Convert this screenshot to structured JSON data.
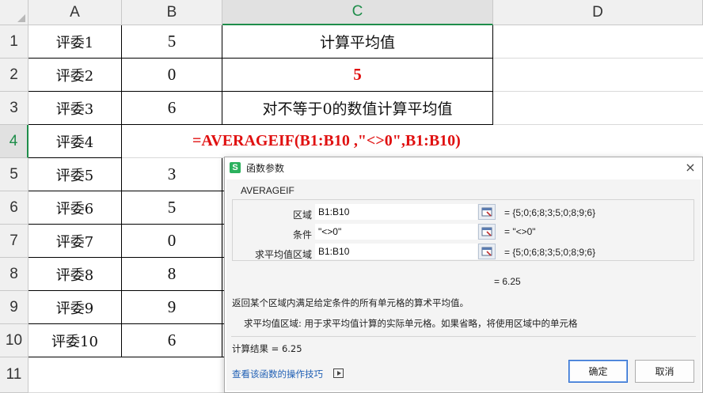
{
  "columns": [
    "A",
    "B",
    "C",
    "D"
  ],
  "rows": [
    "1",
    "2",
    "3",
    "4",
    "5",
    "6",
    "7",
    "8",
    "9",
    "10",
    "11"
  ],
  "cells": {
    "A": [
      "评委1",
      "评委2",
      "评委3",
      "评委4",
      "评委5",
      "评委6",
      "评委7",
      "评委8",
      "评委9",
      "评委10"
    ],
    "B": [
      "5",
      "0",
      "6",
      "",
      "3",
      "5",
      "0",
      "8",
      "9",
      "6"
    ],
    "C1": "计算平均值",
    "C2": "5",
    "C3": "对不等于0的数值计算平均值",
    "formula": "=AVERAGEIF(B1:B10 ,\"<>0\",B1:B10)"
  },
  "dialog": {
    "title": "函数参数",
    "close": "×",
    "function_name": "AVERAGEIF",
    "args": [
      {
        "label": "区域",
        "value": "B1:B10",
        "result": "=  {5;0;6;8;3;5;0;8;9;6}"
      },
      {
        "label": "条件",
        "value": "\"<>0\"",
        "result": "=  \"<>0\""
      },
      {
        "label": "求平均值区域",
        "value": "B1:B10",
        "result": "=  {5;0;6;8;3;5;0;8;9;6}"
      }
    ],
    "formula_result": "=   6.25",
    "description": "返回某个区域内满足给定条件的所有单元格的算术平均值。",
    "arg_description": "求平均值区域:   用于求平均值计算的实际单元格。如果省略，将使用区域中的单元格",
    "calc_result": "计算结果  =   6.25",
    "help_link": "查看该函数的操作技巧",
    "ok": "确定",
    "cancel": "取消"
  },
  "colors": {
    "accent_green": "#1e8d4a",
    "formula_red": "#e01010",
    "link_blue": "#1f5fb4"
  }
}
